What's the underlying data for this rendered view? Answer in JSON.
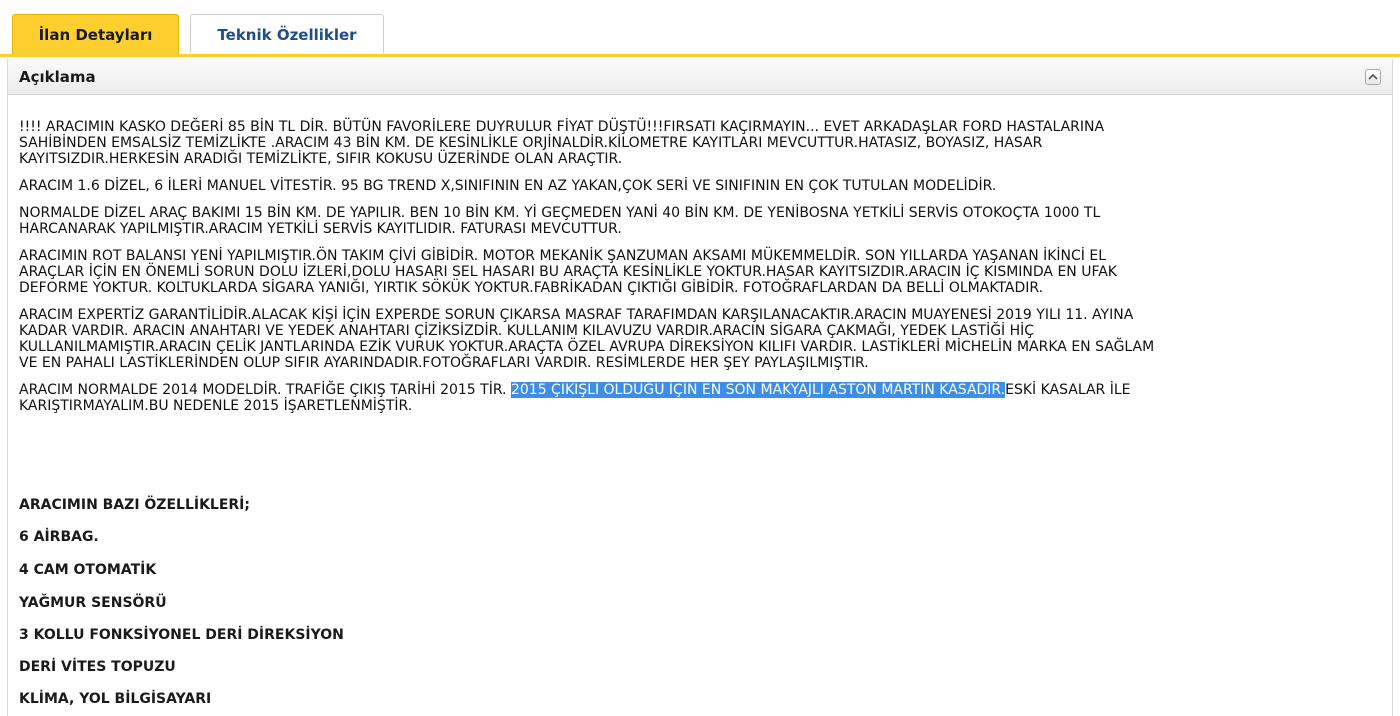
{
  "tabs": {
    "active_label": "İlan Detayları",
    "inactive_label": "Teknik Özellikler"
  },
  "panel": {
    "title": "Açıklama",
    "collapse_icon": "chevron-up-icon"
  },
  "colors": {
    "tab_active": "#fecf2e",
    "tab_inactive_text": "#1e4d8a",
    "highlight": "#3d8ee6"
  },
  "description": {
    "p1": {
      "l1": "!!!! ARACIMIN KASKO DEĞERİ 85 BİN TL DİR. BÜTÜN FAVORİLERE DUYRULUR FİYAT DÜŞTÜ!!!FIRSATI KAÇIRMAYIN... EVET ARKADAŞLAR FORD HASTALARINA",
      "l2": "SAHİBİNDEN EMSALSİZ TEMİZLİKTE .ARACIM 43 BİN KM. DE KESİNLİKLE ORJİNALDİR.KİLOMETRE KAYITLARI MEVCUTTUR.HATASIZ, BOYASIZ, HASAR",
      "l3": "KAYITSIZDIR.HERKESİN ARADIĞI TEMİZLİKTE, SIFIR KOKUSU ÜZERİNDE OLAN ARAÇTIR."
    },
    "p2": {
      "l1": "ARACIM 1.6 DİZEL, 6 İLERİ MANUEL VİTESTİR. 95 BG TREND X,SINIFININ EN AZ YAKAN,ÇOK SERİ VE SINIFININ EN ÇOK TUTULAN MODELİDİR."
    },
    "p3": {
      "l1": "NORMALDE DİZEL ARAÇ BAKIMI 15 BİN KM. DE YAPILIR. BEN 10 BİN KM. Yİ GEÇMEDEN YANİ 40 BİN KM. DE YENİBOSNA YETKİLİ SERVİS OTOKOÇTA 1000 TL",
      "l2": "HARCANARAK YAPILMIŞTIR.ARACIM YETKİLİ SERVİS KAYITLIDIR. FATURASI MEVCUTTUR."
    },
    "p4": {
      "l1": "ARACIMIN ROT BALANSI YENİ YAPILMIŞTIR.ÖN TAKIM ÇİVİ GİBİDİR. MOTOR MEKANİK ŞANZUMAN AKSAMI MÜKEMMELDİR. SON YILLARDA YAŞANAN İKİNCİ EL",
      "l2": "ARAÇLAR İÇİN EN ÖNEMLİ SORUN DOLU İZLERİ,DOLU HASARI SEL HASARI BU ARAÇTA KESİNLİKLE YOKTUR.HASAR KAYITSIZDIR.ARACIN İÇ KISMINDA EN UFAK",
      "l3": "DEFORME YOKTUR. KOLTUKLARDA SİGARA YANIĞI, YIRTIK SÖKÜK YOKTUR.FABRİKADAN ÇIKTIĞI GİBİDİR. FOTOĞRAFLARDAN DA BELLİ OLMAKTADIR."
    },
    "p5": {
      "l1": "ARACIM EXPERTİZ GARANTİLİDİR.ALACAK KİŞİ İÇİN EXPERDE SORUN ÇIKARSA MASRAF TARAFIMDAN KARŞILANACAKTIR.ARACIN MUAYENESİ 2019 YILI 11. AYINA",
      "l2": "KADAR VARDIR. ARACIN ANAHTARI VE YEDEK ANAHTARI ÇİZİKSİZDİR. KULLANIM KILAVUZU VARDIR.ARACIN SİGARA ÇAKMAĞI, YEDEK LASTİĞİ HİÇ",
      "l3": "KULLANILMAMIŞTIR.ARACIN ÇELİK JANTLARINDA EZİK VURUK YOKTUR.ARAÇTA ÖZEL AVRUPA DİREKSİYON KILIFI VARDIR. LASTİKLERİ MİCHELİN MARKA EN SAĞLAM",
      "l4": "VE EN PAHALI LASTİKLERİNDEN OLUP SIFIR AYARINDADIR.FOTOĞRAFLARI VARDIR. RESİMLERDE HER ŞEY PAYLAŞILMIŞTIR."
    },
    "p6": {
      "l1_before": "ARACIM NORMALDE 2014 MODELDİR. TRAFİĞE ÇIKIŞ TARİHİ 2015 TİR. ",
      "l1_highlight": "2015 ÇIKIŞLI OLDUĞU İÇİN EN SON MAKYAJLI ASTON MARTİN KASADIR.",
      "l1_after": "ESKİ KASALAR İLE",
      "l2": "KARIŞTIRMAYALIM.BU NEDENLE 2015 İŞARETLENMİŞTİR."
    }
  },
  "features": {
    "heading": "ARACIMIN BAZI ÖZELLİKLERİ;",
    "item1": "6 AİRBAG.",
    "item2": "4 CAM OTOMATİK",
    "item3": "YAĞMUR SENSÖRÜ",
    "item4": "3 KOLLU FONKSİYONEL DERİ DİREKSİYON",
    "item5": "DERİ VİTES TOPUZU",
    "item6": "KLİMA, YOL BİLGİSAYARI"
  }
}
